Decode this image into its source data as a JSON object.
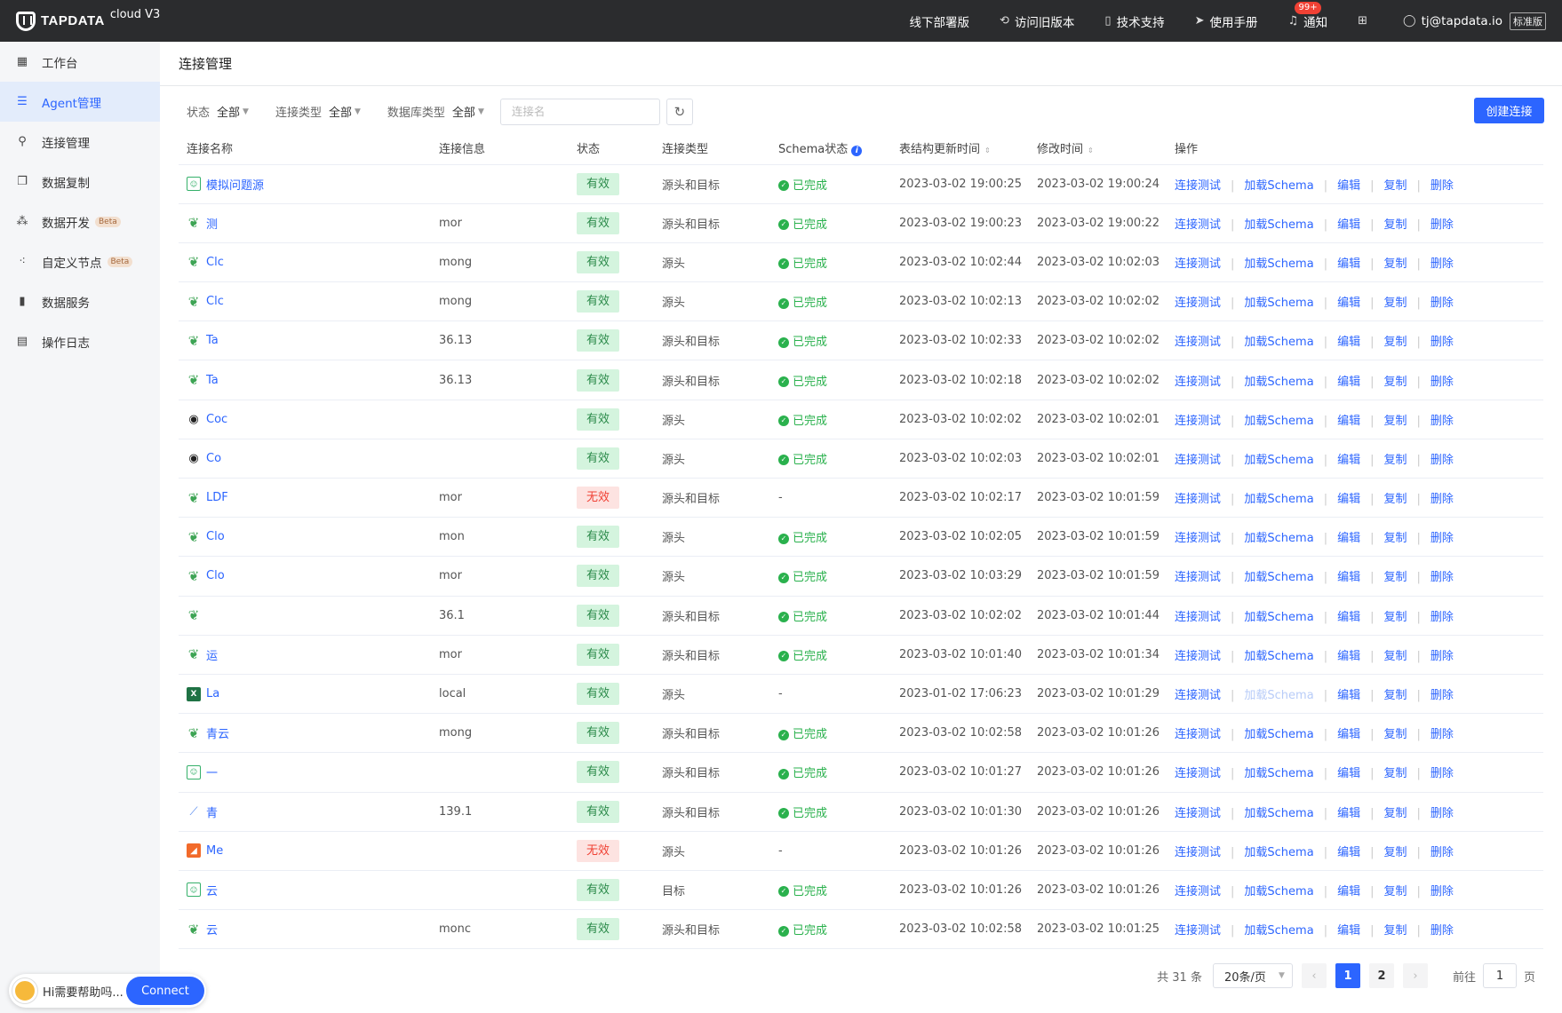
{
  "topbar": {
    "logo": "TAPDATA",
    "version": "cloud V3",
    "nav": [
      {
        "label": "线下部署版",
        "icon": "none"
      },
      {
        "label": "访问旧版本",
        "icon": "switch-icon"
      },
      {
        "label": "技术支持",
        "icon": "support-icon"
      },
      {
        "label": "使用手册",
        "icon": "paper-plane-icon"
      },
      {
        "label": "通知",
        "icon": "bell-icon",
        "badge": "99+"
      }
    ],
    "user": "tj@tapdata.io",
    "edition": "标准版"
  },
  "sidebar": {
    "items": [
      {
        "label": "工作台",
        "beta": ""
      },
      {
        "label": "Agent管理",
        "beta": ""
      },
      {
        "label": "连接管理",
        "beta": ""
      },
      {
        "label": "数据复制",
        "beta": ""
      },
      {
        "label": "数据开发",
        "beta": "Beta"
      },
      {
        "label": "自定义节点",
        "beta": "Beta"
      },
      {
        "label": "数据服务",
        "beta": ""
      },
      {
        "label": "操作日志",
        "beta": ""
      }
    ],
    "active_index": 1
  },
  "page": {
    "title": "连接管理",
    "filters": [
      {
        "label": "状态",
        "value": "全部"
      },
      {
        "label": "连接类型",
        "value": "全部"
      },
      {
        "label": "数据库类型",
        "value": "全部"
      }
    ],
    "search_placeholder": "连接名",
    "create_label": "创建连接"
  },
  "table": {
    "headers": {
      "name": "连接名称",
      "info": "连接信息",
      "status": "状态",
      "type": "连接类型",
      "schema": "Schema状态",
      "schema_time": "表结构更新时间",
      "modified": "修改时间",
      "ops": "操作"
    },
    "ops_labels": {
      "test": "连接测试",
      "load": "加载Schema",
      "edit": "编辑",
      "copy": "复制",
      "delete": "删除"
    },
    "rows": [
      {
        "icon": "generic",
        "name": "模拟问题源",
        "info": "",
        "status": "有效",
        "ok": true,
        "type": "源头和目标",
        "schema": "已完成",
        "schema_time": "2023-03-02 19:00:25",
        "modified": "2023-03-02 19:00:24",
        "load_disabled": false
      },
      {
        "icon": "mongo",
        "name": "测",
        "info": "mor",
        "status": "有效",
        "ok": true,
        "type": "源头和目标",
        "schema": "已完成",
        "schema_time": "2023-03-02 19:00:23",
        "modified": "2023-03-02 19:00:22",
        "load_disabled": false
      },
      {
        "icon": "mongo",
        "name": "Clc",
        "info": "mong",
        "status": "有效",
        "ok": true,
        "type": "源头",
        "schema": "已完成",
        "schema_time": "2023-03-02 10:02:44",
        "modified": "2023-03-02 10:02:03",
        "load_disabled": false
      },
      {
        "icon": "mongo",
        "name": "Clc",
        "info": "mong",
        "status": "有效",
        "ok": true,
        "type": "源头",
        "schema": "已完成",
        "schema_time": "2023-03-02 10:02:13",
        "modified": "2023-03-02 10:02:02",
        "load_disabled": false
      },
      {
        "icon": "mongo",
        "name": "Ta",
        "info": "36.13",
        "status": "有效",
        "ok": true,
        "type": "源头和目标",
        "schema": "已完成",
        "schema_time": "2023-03-02 10:02:33",
        "modified": "2023-03-02 10:02:02",
        "load_disabled": false
      },
      {
        "icon": "mongo",
        "name": "Ta",
        "info": "36.13",
        "status": "有效",
        "ok": true,
        "type": "源头和目标",
        "schema": "已完成",
        "schema_time": "2023-03-02 10:02:18",
        "modified": "2023-03-02 10:02:02",
        "load_disabled": false
      },
      {
        "icon": "eye",
        "name": "Coc",
        "info": "",
        "status": "有效",
        "ok": true,
        "type": "源头",
        "schema": "已完成",
        "schema_time": "2023-03-02 10:02:02",
        "modified": "2023-03-02 10:02:01",
        "load_disabled": false
      },
      {
        "icon": "eye",
        "name": "Co",
        "info": "",
        "status": "有效",
        "ok": true,
        "type": "源头",
        "schema": "已完成",
        "schema_time": "2023-03-02 10:02:03",
        "modified": "2023-03-02 10:02:01",
        "load_disabled": false
      },
      {
        "icon": "mongo",
        "name": "LDF",
        "info": "mor",
        "status": "无效",
        "ok": false,
        "type": "源头和目标",
        "schema": "-",
        "schema_time": "2023-03-02 10:02:17",
        "modified": "2023-03-02 10:01:59",
        "load_disabled": false
      },
      {
        "icon": "mongo",
        "name": "Clo",
        "info": "mon",
        "status": "有效",
        "ok": true,
        "type": "源头",
        "schema": "已完成",
        "schema_time": "2023-03-02 10:02:05",
        "modified": "2023-03-02 10:01:59",
        "load_disabled": false
      },
      {
        "icon": "mongo",
        "name": "Clo",
        "info": "mor",
        "status": "有效",
        "ok": true,
        "type": "源头",
        "schema": "已完成",
        "schema_time": "2023-03-02 10:03:29",
        "modified": "2023-03-02 10:01:59",
        "load_disabled": false
      },
      {
        "icon": "mongo",
        "name": "",
        "info": "36.1",
        "status": "有效",
        "ok": true,
        "type": "源头和目标",
        "schema": "已完成",
        "schema_time": "2023-03-02 10:02:02",
        "modified": "2023-03-02 10:01:44",
        "load_disabled": false
      },
      {
        "icon": "mongo",
        "name": "运",
        "info": "mor",
        "status": "有效",
        "ok": true,
        "type": "源头和目标",
        "schema": "已完成",
        "schema_time": "2023-03-02 10:01:40",
        "modified": "2023-03-02 10:01:34",
        "load_disabled": false
      },
      {
        "icon": "excel",
        "name": "La",
        "info": "local",
        "status": "有效",
        "ok": true,
        "type": "源头",
        "schema": "-",
        "schema_time": "2023-01-02 17:06:23",
        "modified": "2023-03-02 10:01:29",
        "load_disabled": true
      },
      {
        "icon": "mongo",
        "name": "青云",
        "info": "mong",
        "status": "有效",
        "ok": true,
        "type": "源头和目标",
        "schema": "已完成",
        "schema_time": "2023-03-02 10:02:58",
        "modified": "2023-03-02 10:01:26",
        "load_disabled": false
      },
      {
        "icon": "generic",
        "name": "一",
        "info": "",
        "status": "有效",
        "ok": true,
        "type": "源头和目标",
        "schema": "已完成",
        "schema_time": "2023-03-02 10:01:27",
        "modified": "2023-03-02 10:01:26",
        "load_disabled": false
      },
      {
        "icon": "kafka",
        "name": "青",
        "info": "139.1",
        "status": "有效",
        "ok": true,
        "type": "源头和目标",
        "schema": "已完成",
        "schema_time": "2023-03-02 10:01:30",
        "modified": "2023-03-02 10:01:26",
        "load_disabled": false
      },
      {
        "icon": "orange",
        "name": "Me",
        "info": "",
        "status": "无效",
        "ok": false,
        "type": "源头",
        "schema": "-",
        "schema_time": "2023-03-02 10:01:26",
        "modified": "2023-03-02 10:01:26",
        "load_disabled": false
      },
      {
        "icon": "generic",
        "name": "云",
        "info": "",
        "status": "有效",
        "ok": true,
        "type": "目标",
        "schema": "已完成",
        "schema_time": "2023-03-02 10:01:26",
        "modified": "2023-03-02 10:01:26",
        "load_disabled": false
      },
      {
        "icon": "mongo",
        "name": "云",
        "info": "monc",
        "status": "有效",
        "ok": true,
        "type": "源头和目标",
        "schema": "已完成",
        "schema_time": "2023-03-02 10:02:58",
        "modified": "2023-03-02 10:01:25",
        "load_disabled": false
      }
    ]
  },
  "pager": {
    "total": "共 31 条",
    "page_size": "20条/页",
    "pages": [
      "1",
      "2"
    ],
    "current": "1",
    "goto_label": "前往",
    "goto_value": "1",
    "page_suffix": "页"
  },
  "help": {
    "text": "Hi需要帮助吗...",
    "button": "Connect"
  },
  "colors": {
    "primary": "#2c65ff",
    "topbar": "#2b2c2e",
    "success": "#2ab14d",
    "danger": "#f04134"
  }
}
